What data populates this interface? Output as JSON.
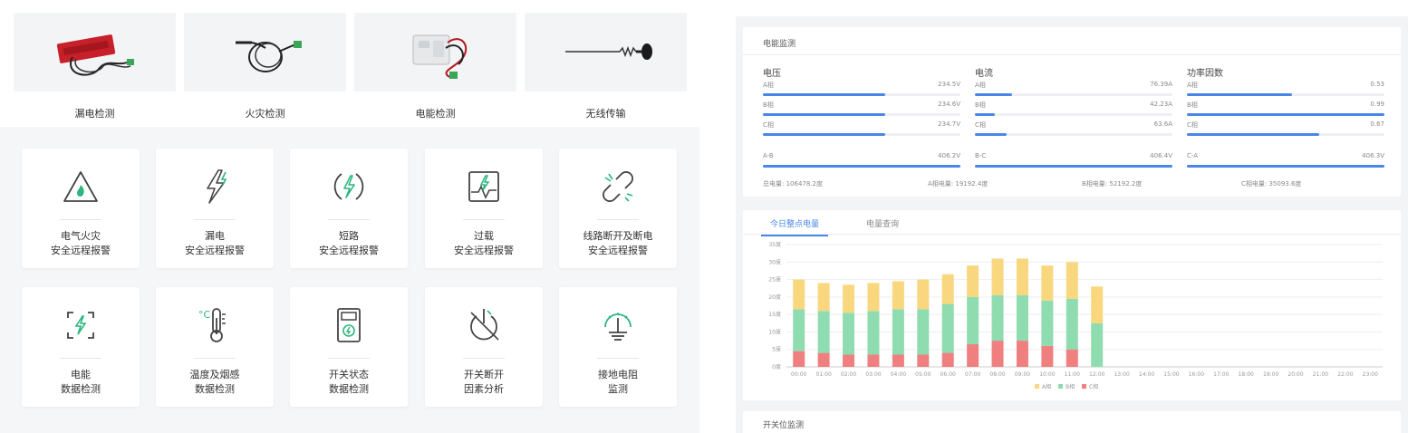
{
  "products": [
    {
      "label": "漏电检测",
      "icon": "leakage-sensor-image"
    },
    {
      "label": "火灾检测",
      "icon": "fire-sensor-cable-image"
    },
    {
      "label": "电能检测",
      "icon": "energy-meter-image"
    },
    {
      "label": "无线传输",
      "icon": "antenna-image"
    }
  ],
  "features": [
    {
      "line1": "电气火灾",
      "line2": "安全远程报警",
      "icon": "fire-warning-icon"
    },
    {
      "line1": "漏电",
      "line2": "安全远程报警",
      "icon": "lightning-leak-icon"
    },
    {
      "line1": "短路",
      "line2": "安全远程报警",
      "icon": "short-circuit-icon"
    },
    {
      "line1": "过载",
      "line2": "安全远程报警",
      "icon": "overload-icon"
    },
    {
      "line1": "线路断开及断电",
      "line2": "安全远程报警",
      "icon": "broken-link-icon"
    },
    {
      "line1": "电能",
      "line2": "数据检测",
      "icon": "energy-scan-icon"
    },
    {
      "line1": "温度及烟感",
      "line2": "数据检测",
      "icon": "thermometer-icon"
    },
    {
      "line1": "开关状态",
      "line2": "数据检测",
      "icon": "switch-device-icon"
    },
    {
      "line1": "开关断开",
      "line2": "因素分析",
      "icon": "power-off-icon"
    },
    {
      "line1": "接地电阻",
      "line2": "监测",
      "icon": "ground-resistance-icon"
    }
  ],
  "monitor": {
    "title": "电能监测",
    "voltage": {
      "title": "电压",
      "rows": [
        {
          "label": "A相",
          "value": "234.5V",
          "level": 0.62
        },
        {
          "label": "B相",
          "value": "234.6V",
          "level": 0.62
        },
        {
          "label": "C相",
          "value": "234.7V",
          "level": 0.62
        },
        {
          "label": "A-B",
          "value": "406.2V",
          "level": 1.0
        }
      ]
    },
    "current": {
      "title": "电流",
      "rows": [
        {
          "label": "A相",
          "value": "76.39A",
          "level": 0.19
        },
        {
          "label": "B相",
          "value": "42.23A",
          "level": 0.1
        },
        {
          "label": "C相",
          "value": "63.6A",
          "level": 0.16
        },
        {
          "label": "B-C",
          "value": "406.4V",
          "level": 1.0
        }
      ]
    },
    "power_factor": {
      "title": "功率因数",
      "rows": [
        {
          "label": "A相",
          "value": "0.53",
          "level": 0.53
        },
        {
          "label": "B相",
          "value": "0.99",
          "level": 1.0
        },
        {
          "label": "C相",
          "value": "0.67",
          "level": 0.67
        },
        {
          "label": "C-A",
          "value": "406.3V",
          "level": 1.0
        }
      ]
    },
    "totals": {
      "total": "总电量: 106478.2度",
      "a": "A相电量: 19192.4度",
      "b": "B相电量: 52192.2度",
      "c": "C相电量: 35093.6度"
    }
  },
  "tabs": {
    "today": "今日整点电量",
    "query": "电量查询"
  },
  "switch_section": {
    "title": "开关位监测"
  },
  "chart_data": {
    "type": "bar",
    "stacked": true,
    "categories": [
      "00:00",
      "01:00",
      "02:00",
      "03:00",
      "04:00",
      "05:00",
      "06:00",
      "07:00",
      "08:00",
      "09:00",
      "10:00",
      "11:00",
      "12:00",
      "13:00",
      "14:00",
      "15:00",
      "16:00",
      "17:00",
      "18:00",
      "19:00",
      "20:00",
      "21:00",
      "22:00",
      "23:00"
    ],
    "yticks": [
      "0度",
      "5度",
      "10度",
      "15度",
      "20度",
      "25度",
      "30度",
      "35度"
    ],
    "ylim": [
      0,
      35
    ],
    "series": [
      {
        "name": "C相",
        "color": "#f08080",
        "values": [
          4.5,
          4,
          3.5,
          3.5,
          3.5,
          3.5,
          4,
          6.5,
          7.5,
          7.5,
          6,
          5,
          null,
          null,
          null,
          null,
          null,
          null,
          null,
          null,
          null,
          null,
          null,
          null
        ]
      },
      {
        "name": "B相",
        "color": "#8fdcb0",
        "values": [
          12,
          12,
          12,
          12.5,
          13,
          13,
          14,
          13.5,
          13,
          13,
          13,
          14.5,
          12.5,
          null,
          null,
          null,
          null,
          null,
          null,
          null,
          null,
          null,
          null,
          null
        ]
      },
      {
        "name": "A相",
        "color": "#f9d77e",
        "values": [
          8.5,
          8,
          8,
          8,
          8,
          8.5,
          8.5,
          9,
          10.5,
          10.5,
          10,
          10.5,
          10.5,
          null,
          null,
          null,
          null,
          null,
          null,
          null,
          null,
          null,
          null,
          null
        ]
      }
    ],
    "legend": [
      "A相",
      "B相",
      "C相"
    ],
    "legend_position": "bottom"
  }
}
